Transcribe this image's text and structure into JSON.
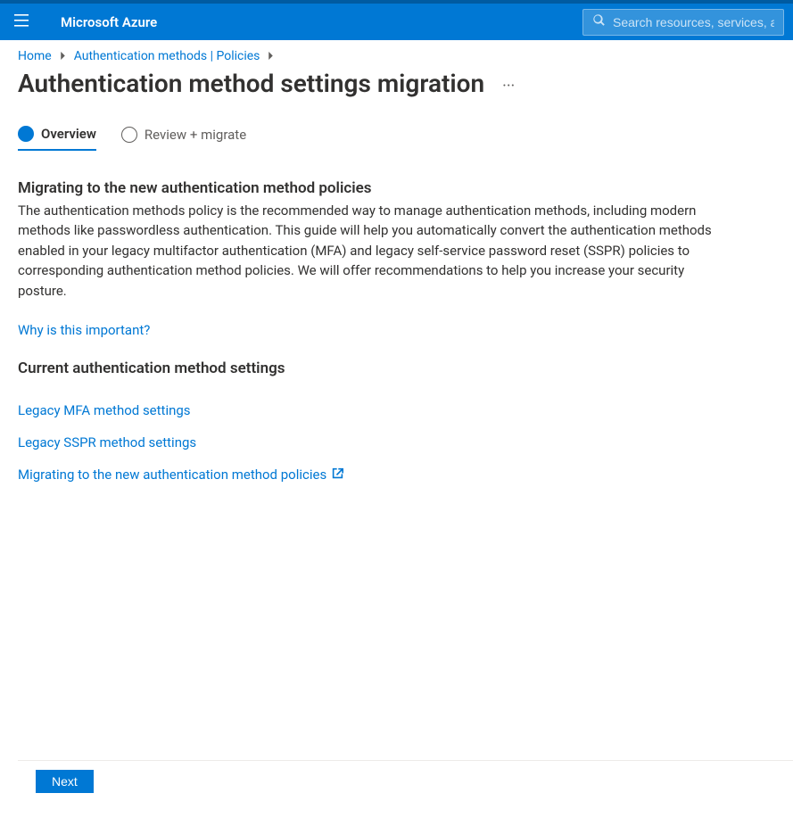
{
  "brand": "Microsoft Azure",
  "search": {
    "placeholder": "Search resources, services, and docs"
  },
  "breadcrumbs": {
    "home": "Home",
    "auth": "Authentication methods | Policies"
  },
  "page": {
    "title": "Authentication method settings migration"
  },
  "steps": {
    "overview": "Overview",
    "review": "Review + migrate"
  },
  "overview": {
    "heading": "Migrating to the new authentication method policies",
    "body": "The authentication methods policy is the recommended way to manage authentication methods, including modern methods like passwordless authentication. This guide will help you automatically convert the authentication methods enabled in your legacy multifactor authentication (MFA) and legacy self-service password reset (SSPR) policies to corresponding authentication method policies. We will offer recommendations to help you increase your security posture.",
    "why_link": "Why is this important?",
    "current_heading": "Current authentication method settings",
    "legacy_mfa_link": "Legacy MFA method settings",
    "legacy_sspr_link": "Legacy SSPR method settings",
    "migrate_link": "Migrating to the new authentication method policies"
  },
  "footer": {
    "next": "Next"
  }
}
